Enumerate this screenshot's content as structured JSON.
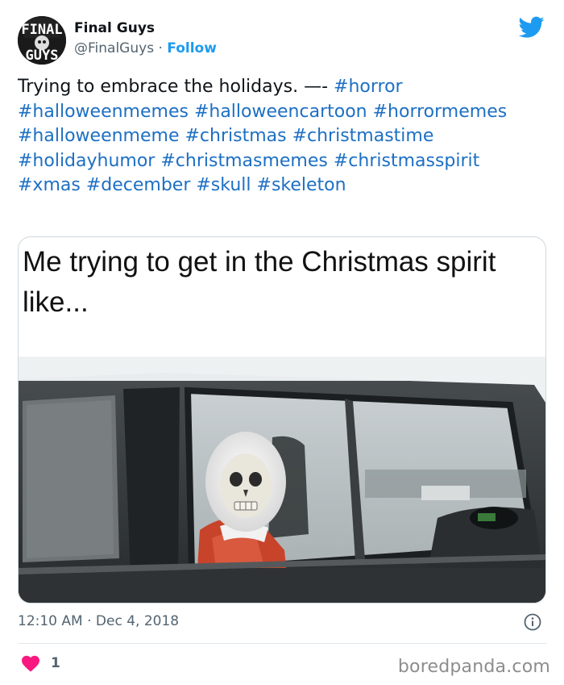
{
  "account": {
    "name": "Final Guys",
    "handle": "@FinalGuys",
    "separator": " · ",
    "follow_label": "Follow",
    "avatar_text_top": "FINAL",
    "avatar_text_bottom": "GUYS"
  },
  "tweet": {
    "text_prefix": "Trying to embrace the holidays. —- ",
    "hashtags": [
      "#horror",
      "#halloweenmemes",
      "#halloweencartoon",
      "#horrormemes",
      "#halloweenmeme",
      "#christmas",
      "#christmastime",
      "#holidayhumor",
      "#christmasmemes",
      "#christmasspirit",
      "#xmas",
      "#december",
      "#skull",
      "#skeleton"
    ]
  },
  "media": {
    "caption": "Me trying to get in the Christmas spirit like..."
  },
  "meta": {
    "timestamp": "12:10 AM · Dec 4, 2018",
    "likes": "1"
  },
  "watermark": "boredpanda.com",
  "colors": {
    "accent": "#1d9bf0",
    "hashtag": "#1d6fc4",
    "heart": "#f91880",
    "muted": "#536471"
  },
  "icons": {
    "brand": "twitter-bird-icon",
    "info": "info-icon",
    "like": "heart-icon"
  }
}
